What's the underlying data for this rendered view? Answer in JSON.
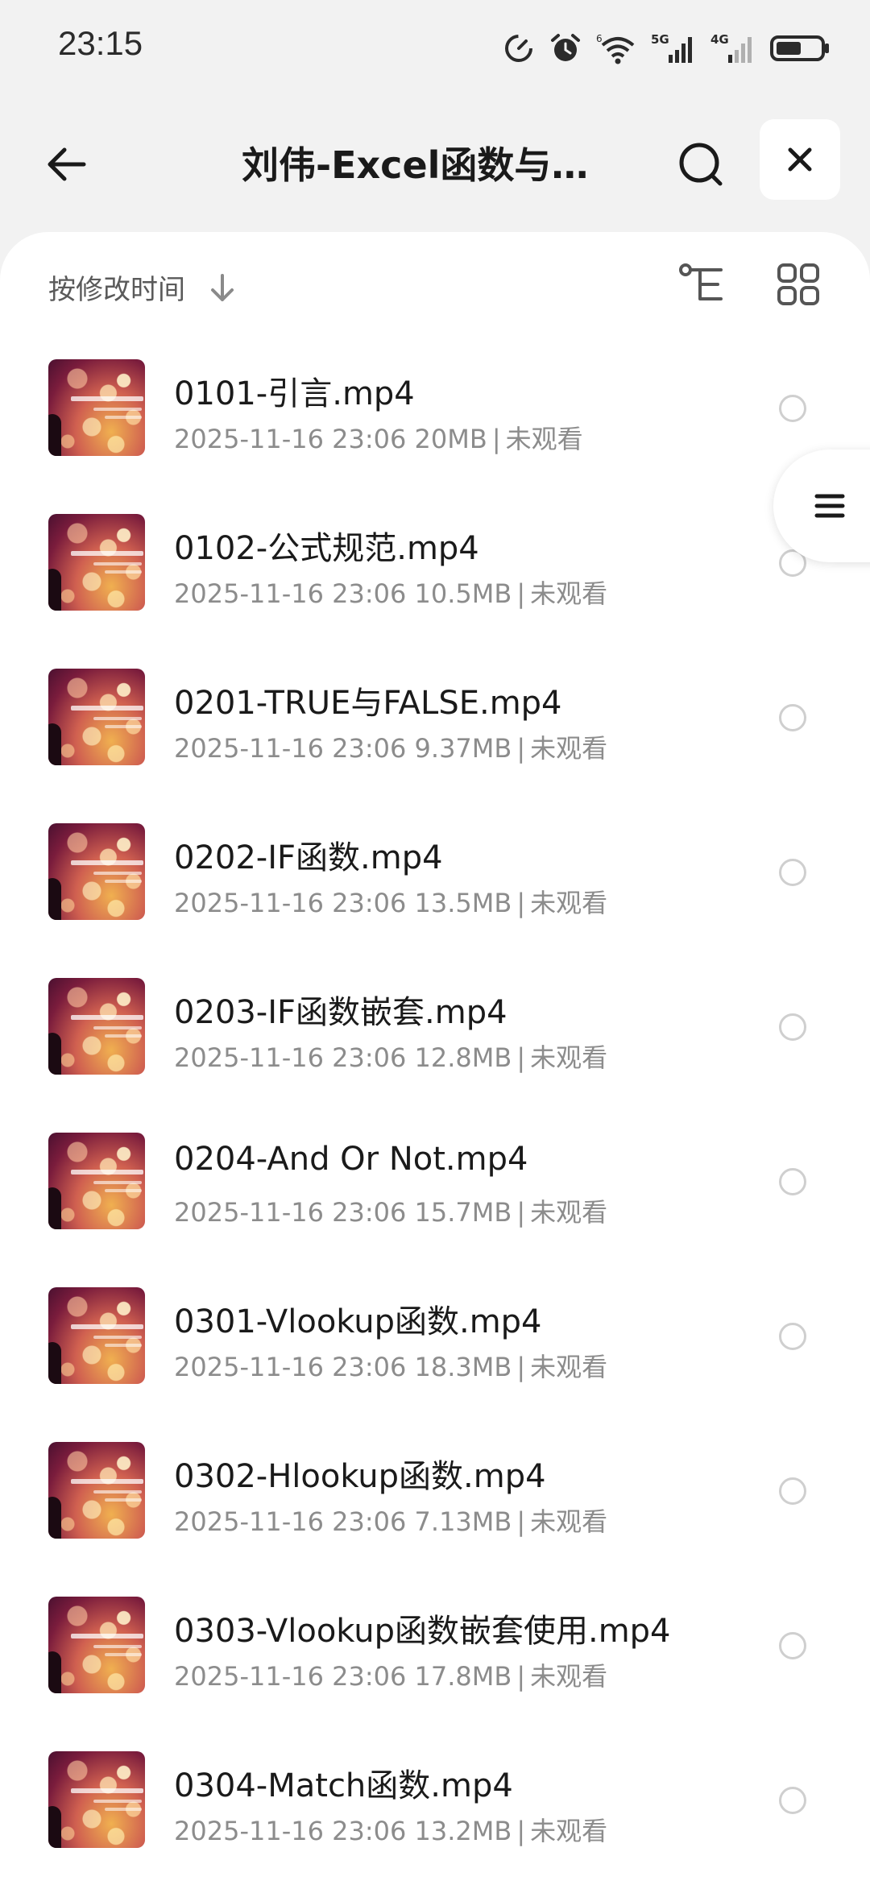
{
  "status_bar": {
    "time": "23:15",
    "icons": [
      "speed-icon",
      "alarm-icon",
      "wifi-icon",
      "signal-5g-icon",
      "signal-4g-icon",
      "battery-icon"
    ],
    "network_labels": {
      "wifi": "6",
      "sim1": "5G",
      "sim2": "4G"
    }
  },
  "header": {
    "title": "刘伟-Excel函数与…",
    "icons": {
      "back": "back-arrow-icon",
      "search": "search-icon",
      "close": "close-icon"
    }
  },
  "toolbar": {
    "sort_label": "按修改时间",
    "sort_direction": "descending",
    "icons": {
      "tree": "tree-view-icon",
      "grid": "grid-view-icon"
    }
  },
  "side_handle": {
    "icon": "menu-lines-icon"
  },
  "files": [
    {
      "name": "0101-引言.mp4",
      "date": "2025-11-16 23:06",
      "size": "20MB",
      "status": "未观看"
    },
    {
      "name": "0102-公式规范.mp4",
      "date": "2025-11-16 23:06",
      "size": "10.5MB",
      "status": "未观看"
    },
    {
      "name": "0201-TRUE与FALSE.mp4",
      "date": "2025-11-16 23:06",
      "size": "9.37MB",
      "status": "未观看"
    },
    {
      "name": "0202-IF函数.mp4",
      "date": "2025-11-16 23:06",
      "size": "13.5MB",
      "status": "未观看"
    },
    {
      "name": "0203-IF函数嵌套.mp4",
      "date": "2025-11-16 23:06",
      "size": "12.8MB",
      "status": "未观看"
    },
    {
      "name": "0204-And Or Not.mp4",
      "date": "2025-11-16 23:06",
      "size": "15.7MB",
      "status": "未观看"
    },
    {
      "name": "0301-Vlookup函数.mp4",
      "date": "2025-11-16 23:06",
      "size": "18.3MB",
      "status": "未观看"
    },
    {
      "name": "0302-Hlookup函数.mp4",
      "date": "2025-11-16 23:06",
      "size": "7.13MB",
      "status": "未观看"
    },
    {
      "name": "0303-Vlookup函数嵌套使用.mp4",
      "date": "2025-11-16 23:06",
      "size": "17.8MB",
      "status": "未观看"
    },
    {
      "name": "0304-Match函数.mp4",
      "date": "2025-11-16 23:06",
      "size": "13.2MB",
      "status": "未观看"
    }
  ]
}
